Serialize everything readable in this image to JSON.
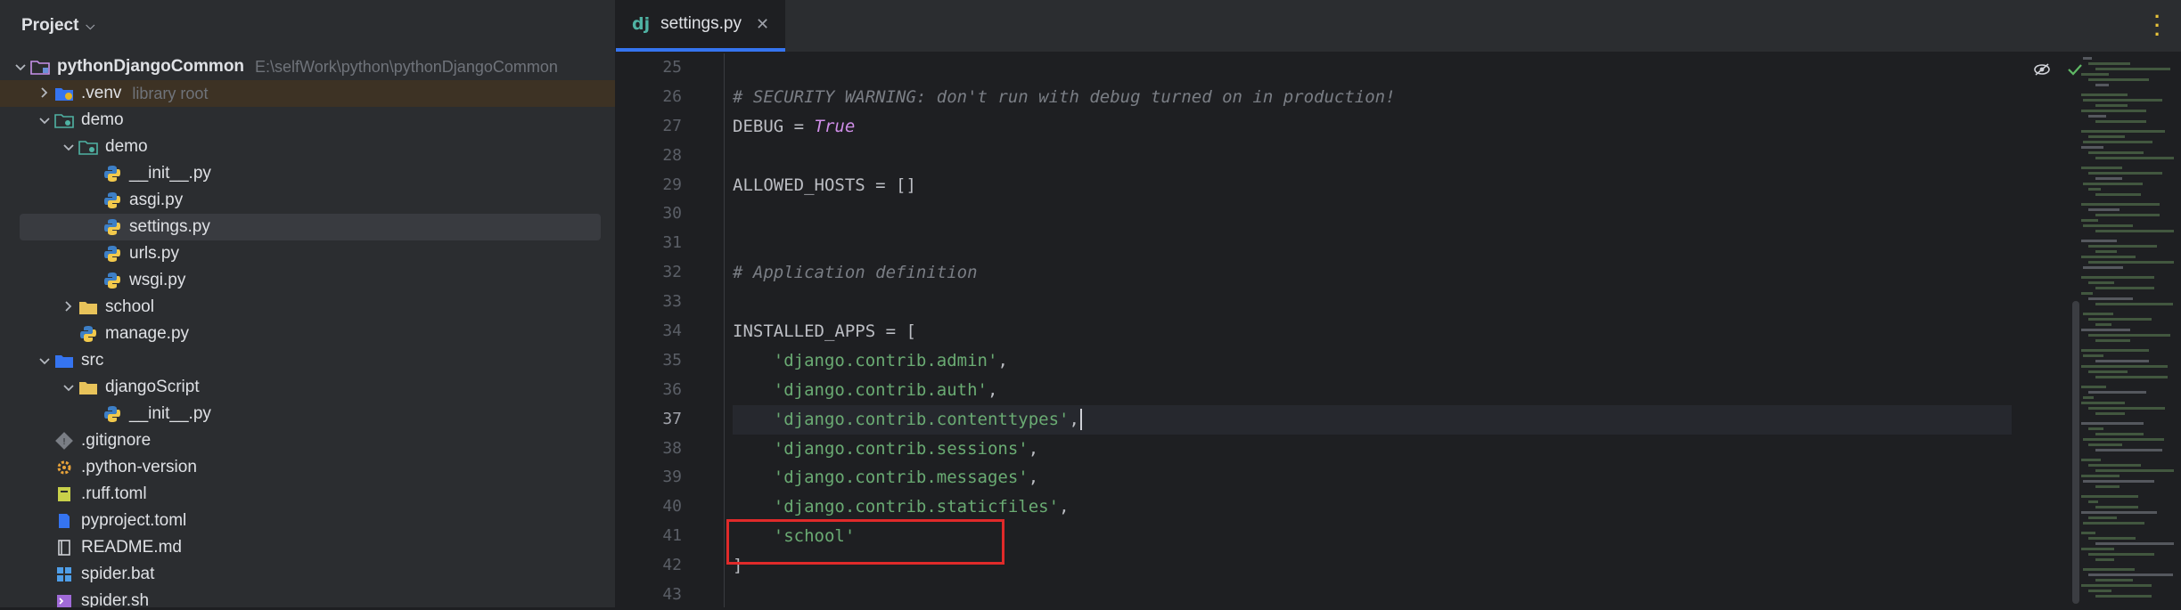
{
  "project_pane": {
    "title": "Project",
    "tree": [
      {
        "indent": 0,
        "arrow": "open",
        "icon": "module-folder",
        "label": "pythonDjangoCommon",
        "hint": "E:\\selfWork\\python\\pythonDjangoCommon",
        "bold": true
      },
      {
        "indent": 1,
        "arrow": "closed",
        "icon": "venv-folder",
        "label": ".venv",
        "hint": "library root",
        "lib": true
      },
      {
        "indent": 1,
        "arrow": "open",
        "icon": "package-folder",
        "label": "demo"
      },
      {
        "indent": 2,
        "arrow": "open",
        "icon": "package-folder",
        "label": "demo"
      },
      {
        "indent": 3,
        "arrow": "none",
        "icon": "python-file",
        "label": "__init__.py"
      },
      {
        "indent": 3,
        "arrow": "none",
        "icon": "python-file",
        "label": "asgi.py"
      },
      {
        "indent": 3,
        "arrow": "none",
        "icon": "python-file",
        "label": "settings.py",
        "selected": true
      },
      {
        "indent": 3,
        "arrow": "none",
        "icon": "python-file",
        "label": "urls.py"
      },
      {
        "indent": 3,
        "arrow": "none",
        "icon": "python-file",
        "label": "wsgi.py"
      },
      {
        "indent": 2,
        "arrow": "closed",
        "icon": "folder",
        "label": "school"
      },
      {
        "indent": 2,
        "arrow": "none",
        "icon": "python-file",
        "label": "manage.py"
      },
      {
        "indent": 1,
        "arrow": "open",
        "icon": "source-folder",
        "label": "src"
      },
      {
        "indent": 2,
        "arrow": "open",
        "icon": "folder",
        "label": "djangoScript"
      },
      {
        "indent": 3,
        "arrow": "none",
        "icon": "python-file",
        "label": "__init__.py"
      },
      {
        "indent": 1,
        "arrow": "none",
        "icon": "gitignore-file",
        "label": ".gitignore"
      },
      {
        "indent": 1,
        "arrow": "none",
        "icon": "config-file",
        "label": ".python-version"
      },
      {
        "indent": 1,
        "arrow": "none",
        "icon": "toml-file",
        "label": ".ruff.toml"
      },
      {
        "indent": 1,
        "arrow": "none",
        "icon": "toml-file-blue",
        "label": "pyproject.toml"
      },
      {
        "indent": 1,
        "arrow": "none",
        "icon": "markdown-file",
        "label": "README.md"
      },
      {
        "indent": 1,
        "arrow": "none",
        "icon": "windows-bat-file",
        "label": "spider.bat"
      },
      {
        "indent": 1,
        "arrow": "none",
        "icon": "shell-file",
        "label": "spider.sh"
      }
    ]
  },
  "editor": {
    "tab": {
      "badge": "dj",
      "label": "settings.py"
    },
    "lines": [
      {
        "n": "25",
        "tokens": []
      },
      {
        "n": "26",
        "tokens": [
          {
            "t": "cmt",
            "v": "# SECURITY WARNING: don't run with debug turned on in production!"
          }
        ]
      },
      {
        "n": "27",
        "tokens": [
          {
            "t": "plain",
            "v": "DEBUG = "
          },
          {
            "t": "kw",
            "v": "True"
          }
        ]
      },
      {
        "n": "28",
        "tokens": []
      },
      {
        "n": "29",
        "tokens": [
          {
            "t": "plain",
            "v": "ALLOWED_HOSTS = []"
          }
        ]
      },
      {
        "n": "30",
        "tokens": []
      },
      {
        "n": "31",
        "tokens": []
      },
      {
        "n": "32",
        "tokens": [
          {
            "t": "cmt",
            "v": "# Application definition"
          }
        ]
      },
      {
        "n": "33",
        "tokens": []
      },
      {
        "n": "34",
        "tokens": [
          {
            "t": "plain",
            "v": "INSTALLED_APPS = ["
          }
        ]
      },
      {
        "n": "35",
        "tokens": [
          {
            "t": "plain",
            "v": "    "
          },
          {
            "t": "str",
            "v": "'django.contrib.admin'"
          },
          {
            "t": "plain",
            "v": ","
          }
        ]
      },
      {
        "n": "36",
        "tokens": [
          {
            "t": "plain",
            "v": "    "
          },
          {
            "t": "str",
            "v": "'django.contrib.auth'"
          },
          {
            "t": "plain",
            "v": ","
          }
        ]
      },
      {
        "n": "37",
        "current": true,
        "tokens": [
          {
            "t": "plain",
            "v": "    "
          },
          {
            "t": "str",
            "v": "'django.contrib.contenttypes'"
          },
          {
            "t": "plain",
            "v": ","
          }
        ]
      },
      {
        "n": "38",
        "tokens": [
          {
            "t": "plain",
            "v": "    "
          },
          {
            "t": "str",
            "v": "'django.contrib.sessions'"
          },
          {
            "t": "plain",
            "v": ","
          }
        ]
      },
      {
        "n": "39",
        "tokens": [
          {
            "t": "plain",
            "v": "    "
          },
          {
            "t": "str",
            "v": "'django.contrib.messages'"
          },
          {
            "t": "plain",
            "v": ","
          }
        ]
      },
      {
        "n": "40",
        "tokens": [
          {
            "t": "plain",
            "v": "    "
          },
          {
            "t": "str",
            "v": "'django.contrib.staticfiles'"
          },
          {
            "t": "plain",
            "v": ","
          }
        ]
      },
      {
        "n": "41",
        "tokens": [
          {
            "t": "plain",
            "v": "    "
          },
          {
            "t": "str",
            "v": "'school'"
          }
        ]
      },
      {
        "n": "42",
        "tokens": [
          {
            "t": "plain",
            "v": "]"
          }
        ]
      },
      {
        "n": "43",
        "tokens": []
      }
    ]
  },
  "colors": {
    "accent": "#3574f0",
    "highlight_box": "#e02a2a",
    "string": "#6aab73",
    "keyword": "#cf8ee8",
    "comment": "#7a7e85"
  }
}
